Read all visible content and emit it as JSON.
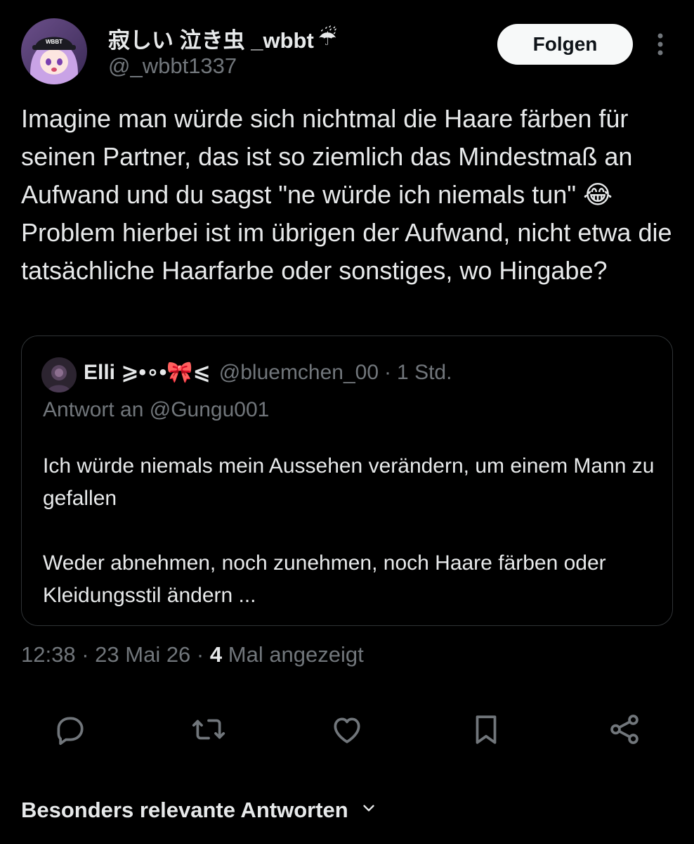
{
  "author": {
    "display_name": "寂しい 泣き虫 _wbbt",
    "name_emoji": "☔",
    "handle": "@_wbbt1337",
    "avatar_icon": "avatar-anime-girl",
    "avatar_cap_text": "WBBT"
  },
  "follow_label": "Folgen",
  "more_icon": "more-vertical-icon",
  "tweet": {
    "text": "Imagine man würde sich nichtmal die Haare färben für seinen Partner, das ist so ziemlich das Mindestmaß an Aufwand und du sagst \"ne würde ich niemals tun\" 😂 Problem hierbei ist im übrigen der Aufwand, nicht etwa die tatsächliche Haarfarbe oder sonstiges, wo Hingabe?"
  },
  "quote": {
    "display_name": "Elli ⩾•∘•🎀⩽",
    "handle": "@bluemchen_00",
    "separator": "·",
    "time": "1 Std.",
    "reply_to": "Antwort an @Gungu001",
    "paragraph_1": "Ich würde niemals mein Aussehen verändern, um einem Mann zu gefallen",
    "paragraph_2": "Weder abnehmen, noch zunehmen, noch Haare färben oder Kleidungsstil ändern ..."
  },
  "meta": {
    "time": "12:38",
    "date": "23 Mai 26",
    "separator": "·",
    "views_count": "4",
    "views_label": "Mal angezeigt"
  },
  "actions": [
    {
      "icon": "reply-icon"
    },
    {
      "icon": "retweet-icon"
    },
    {
      "icon": "like-icon"
    },
    {
      "icon": "bookmark-icon"
    },
    {
      "icon": "share-icon"
    }
  ],
  "replies_sort": {
    "label": "Besonders relevante Antworten",
    "icon": "chevron-down-icon"
  },
  "colors": {
    "background": "#000000",
    "text": "#e7e9ea",
    "muted": "#71767b",
    "border": "#2f3336",
    "button_bg": "#f7f9f9",
    "button_text": "#0f1419"
  }
}
